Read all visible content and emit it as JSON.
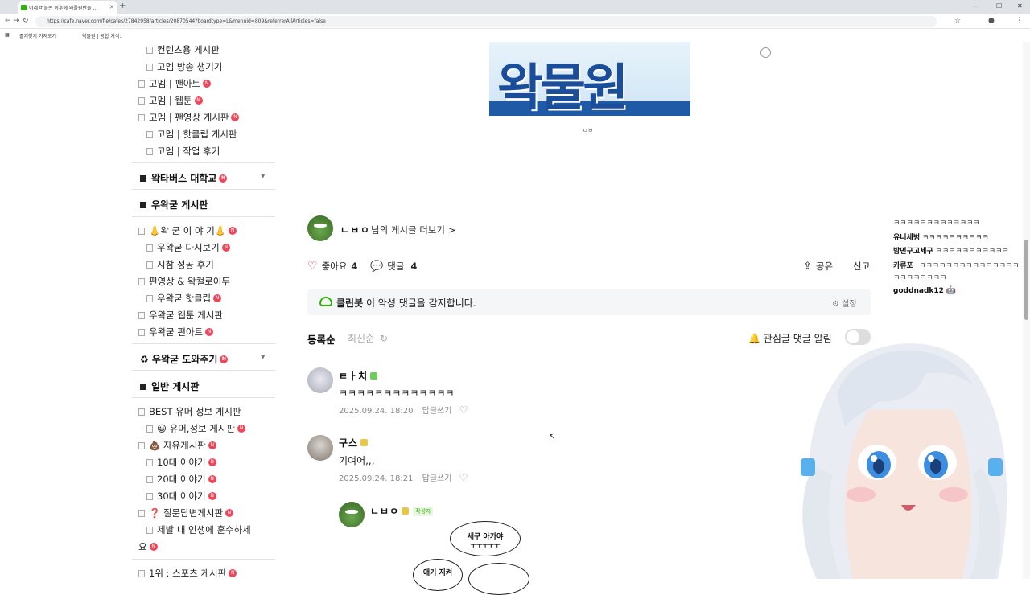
{
  "browser": {
    "tab_title": "이제 버블콘 이후에 와플원반들 ...",
    "url": "https://cafe.naver.com/f-e/cafes/27842958/articles/20870544?boardtype=L&menuid=809&referrerAllArticles=false",
    "bookmarks": [
      "즐겨찾기 가져오기",
      "왁물원 | 왕합 거식.."
    ]
  },
  "sidebar": {
    "items": [
      {
        "label": "컨텐츠용 게시판",
        "indent": true,
        "new": false
      },
      {
        "label": "고멤 방송 챙기기",
        "indent": true,
        "new": false
      },
      {
        "label": "고멤 | 팬아트",
        "indent": false,
        "new": true
      },
      {
        "label": "고멤 | 웹툰",
        "indent": false,
        "new": true
      },
      {
        "label": "고멤 | 팬영상 게시판",
        "indent": false,
        "new": true
      },
      {
        "label": "고멤 | 핫클립 게시판",
        "indent": true,
        "new": false
      },
      {
        "label": "고멤 | 작업 후기",
        "indent": true,
        "new": false
      }
    ],
    "section_waktaverse": "왁타버스 대학교",
    "section_uwakgun": "우왁굳 게시판",
    "uwakgun_items": [
      {
        "label": "👃왁 굳 이 야 기👃",
        "indent": false,
        "new": true
      },
      {
        "label": "우왁굳 다시보기",
        "indent": true,
        "new": true
      },
      {
        "label": "시참 성공 후기",
        "indent": true,
        "new": false
      },
      {
        "label": "편영상 & 왁컬로이두",
        "indent": false,
        "new": false
      },
      {
        "label": "우왁굳 핫클립",
        "indent": true,
        "new": true
      },
      {
        "label": "우왁굳 웹툰 게시판",
        "indent": false,
        "new": false
      },
      {
        "label": "우왁굳 편아트",
        "indent": false,
        "new": true
      }
    ],
    "section_help": "♻ 우왁굳 도와주기",
    "section_general": "일반 게시판",
    "general_items": [
      {
        "label": "BEST 유머 정보 게시판",
        "indent": false,
        "new": false
      },
      {
        "label": "😀 유머,정보 게시판",
        "indent": true,
        "new": true
      },
      {
        "label": "💩 자유게시판",
        "indent": false,
        "new": true
      },
      {
        "label": "10대 이야기",
        "indent": true,
        "new": true
      },
      {
        "label": "20대 이야기",
        "indent": true,
        "new": true
      },
      {
        "label": "30대 이야기",
        "indent": true,
        "new": true
      },
      {
        "label": "❓ 질문답변게시판",
        "indent": false,
        "new": true
      },
      {
        "label": "제발 내 인생에 훈수하세",
        "indent": true,
        "new": false
      },
      {
        "label": "요",
        "indent": false,
        "new": true
      },
      {
        "label": "1위 : 스포츠 게시판",
        "indent": false,
        "new": true
      }
    ],
    "new_badge": "N"
  },
  "article": {
    "logo_text": "왁물원",
    "caption": "ㅁㅂ",
    "author": "ㄴㅂㅇ",
    "more_posts": "님의 게시글 더보기 >",
    "like_label": "좋아요",
    "like_count": "4",
    "comment_label": "댓글",
    "comment_count": "4",
    "share_label": "공유",
    "report_label": "신고"
  },
  "cleanbot": {
    "name": "클린봇",
    "text": "이 악성 댓글을 감지합니다.",
    "settings": "설정"
  },
  "comments_header": {
    "sort_registered": "등록순",
    "sort_latest": "최신순",
    "watch_label": "관심글 댓글 알림"
  },
  "comments": [
    {
      "name": "ㅌㅏ치",
      "text": "ㅋㅋㅋㅋㅋㅋㅋㅋㅋㅋㅋㅋㅋ",
      "date": "2025.09.24. 18:20",
      "reply": "답글쓰기"
    },
    {
      "name": "구스",
      "text": "기여어,,,",
      "date": "2025.09.24. 18:21",
      "reply": "답글쓰기"
    },
    {
      "name": "ㄴㅂㅇ",
      "tag": "작성자",
      "bubble1": "세구 아가야",
      "bubble1_sub": "ㅜㅜㅜㅜㅜ",
      "bubble2": "애기 지켜"
    }
  ],
  "chat": [
    {
      "name": "",
      "text": "ㅋㅋㅋㅋㅋㅋㅋㅋㅋㅋㅋㅋㅋ"
    },
    {
      "name": "유니세벙",
      "text": "ㅋㅋㅋㅋㅋㅋㅋㅋㅋㅋ"
    },
    {
      "name": "밤먼구고세구",
      "text": "ㅋㅋㅋㅋㅋㅋㅋㅋㅋㅋㅋ"
    },
    {
      "name": "카류포_",
      "text": "ㅋㅋㅋㅋㅋㅋㅋㅋㅋㅋㅋㅋㅋㅋㅋ"
    },
    {
      "name": "",
      "text": "ㅋㅋㅋㅋㅋㅋㅋㅋ"
    },
    {
      "name": "goddnadk12",
      "text": ""
    }
  ],
  "colors": {
    "naver_green": "#2db400",
    "new_badge": "#f0465a",
    "logo_blue": "#1a4e9a"
  }
}
